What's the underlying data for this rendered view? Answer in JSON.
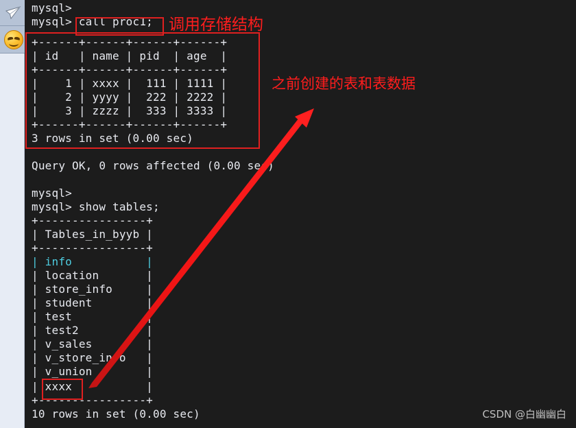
{
  "sidebar": {
    "icons": [
      {
        "name": "paper-plane-icon",
        "label": "paper-plane"
      },
      {
        "name": "smiley-face-icon",
        "label": "smiley-face"
      }
    ]
  },
  "terminal": {
    "prompt": "mysql>",
    "lines": [
      {
        "id": "l00",
        "text": "mysql>"
      },
      {
        "id": "l01",
        "text": "mysql> call proc1;"
      },
      {
        "id": "l02",
        "text": "+------+------+------+------+"
      },
      {
        "id": "l03",
        "text": "| id   | name | pid  | age  |"
      },
      {
        "id": "l04",
        "text": "+------+------+------+------+"
      },
      {
        "id": "l05",
        "text": "|    1 | xxxx |  111 | 1111 |"
      },
      {
        "id": "l06",
        "text": "|    2 | yyyy |  222 | 2222 |"
      },
      {
        "id": "l07",
        "text": "|    3 | zzzz |  333 | 3333 |"
      },
      {
        "id": "l08",
        "text": "+------+------+------+------+"
      },
      {
        "id": "l09",
        "text": "3 rows in set (0.00 sec)"
      },
      {
        "id": "l10",
        "text": ""
      },
      {
        "id": "l11",
        "text": "Query OK, 0 rows affected (0.00 sec)"
      },
      {
        "id": "l12",
        "text": ""
      },
      {
        "id": "l13",
        "text": "mysql>"
      },
      {
        "id": "l14",
        "text": "mysql> show tables;"
      },
      {
        "id": "l15",
        "text": "+----------------+"
      },
      {
        "id": "l16",
        "text": "| Tables_in_byyb |"
      },
      {
        "id": "l17",
        "text": "+----------------+"
      },
      {
        "id": "l18",
        "text": "| info           |"
      },
      {
        "id": "l19",
        "text": "| location       |"
      },
      {
        "id": "l20",
        "text": "| store_info     |"
      },
      {
        "id": "l21",
        "text": "| student        |"
      },
      {
        "id": "l22",
        "text": "| test           |"
      },
      {
        "id": "l23",
        "text": "| test2          |"
      },
      {
        "id": "l24",
        "text": "| v_sales        |"
      },
      {
        "id": "l25",
        "text": "| v_store_info   |"
      },
      {
        "id": "l26",
        "text": "| v_union        |"
      },
      {
        "id": "l27",
        "text": "| xxxx           |"
      },
      {
        "id": "l28",
        "text": "+----------------+"
      },
      {
        "id": "l29",
        "text": "10 rows in set (0.00 sec)"
      }
    ],
    "commands": {
      "call_proc": "call proc1;",
      "show_tables": "show tables;"
    },
    "result_table": {
      "headers": [
        "id",
        "name",
        "pid",
        "age"
      ],
      "rows": [
        [
          "1",
          "xxxx",
          "111",
          "1111"
        ],
        [
          "2",
          "yyyy",
          "222",
          "2222"
        ],
        [
          "3",
          "zzzz",
          "333",
          "3333"
        ]
      ],
      "footer": "3 rows in set (0.00 sec)"
    },
    "tables_list": {
      "header": "Tables_in_byyb",
      "items": [
        "info",
        "location",
        "store_info",
        "student",
        "test",
        "test2",
        "v_sales",
        "v_store_info",
        "v_union",
        "xxxx"
      ],
      "highlighted": "info",
      "footer": "10 rows in set (0.00 sec)"
    },
    "query_status": "Query OK, 0 rows affected (0.00 sec)"
  },
  "annotations": {
    "call_label": "调用存储结构",
    "table_label": "之前创建的表和表数据",
    "color": "#ff1d1d"
  },
  "watermark": "CSDN @白幽幽白",
  "colors": {
    "terminal_bg": "#1c1c1c",
    "terminal_fg": "#e8eaf0",
    "highlight_cyan": "#4ecde0",
    "border_pipe": "#d9a05a",
    "annotation_red": "#ff1d1d",
    "sidebar_bg": "#e7ecf5"
  }
}
